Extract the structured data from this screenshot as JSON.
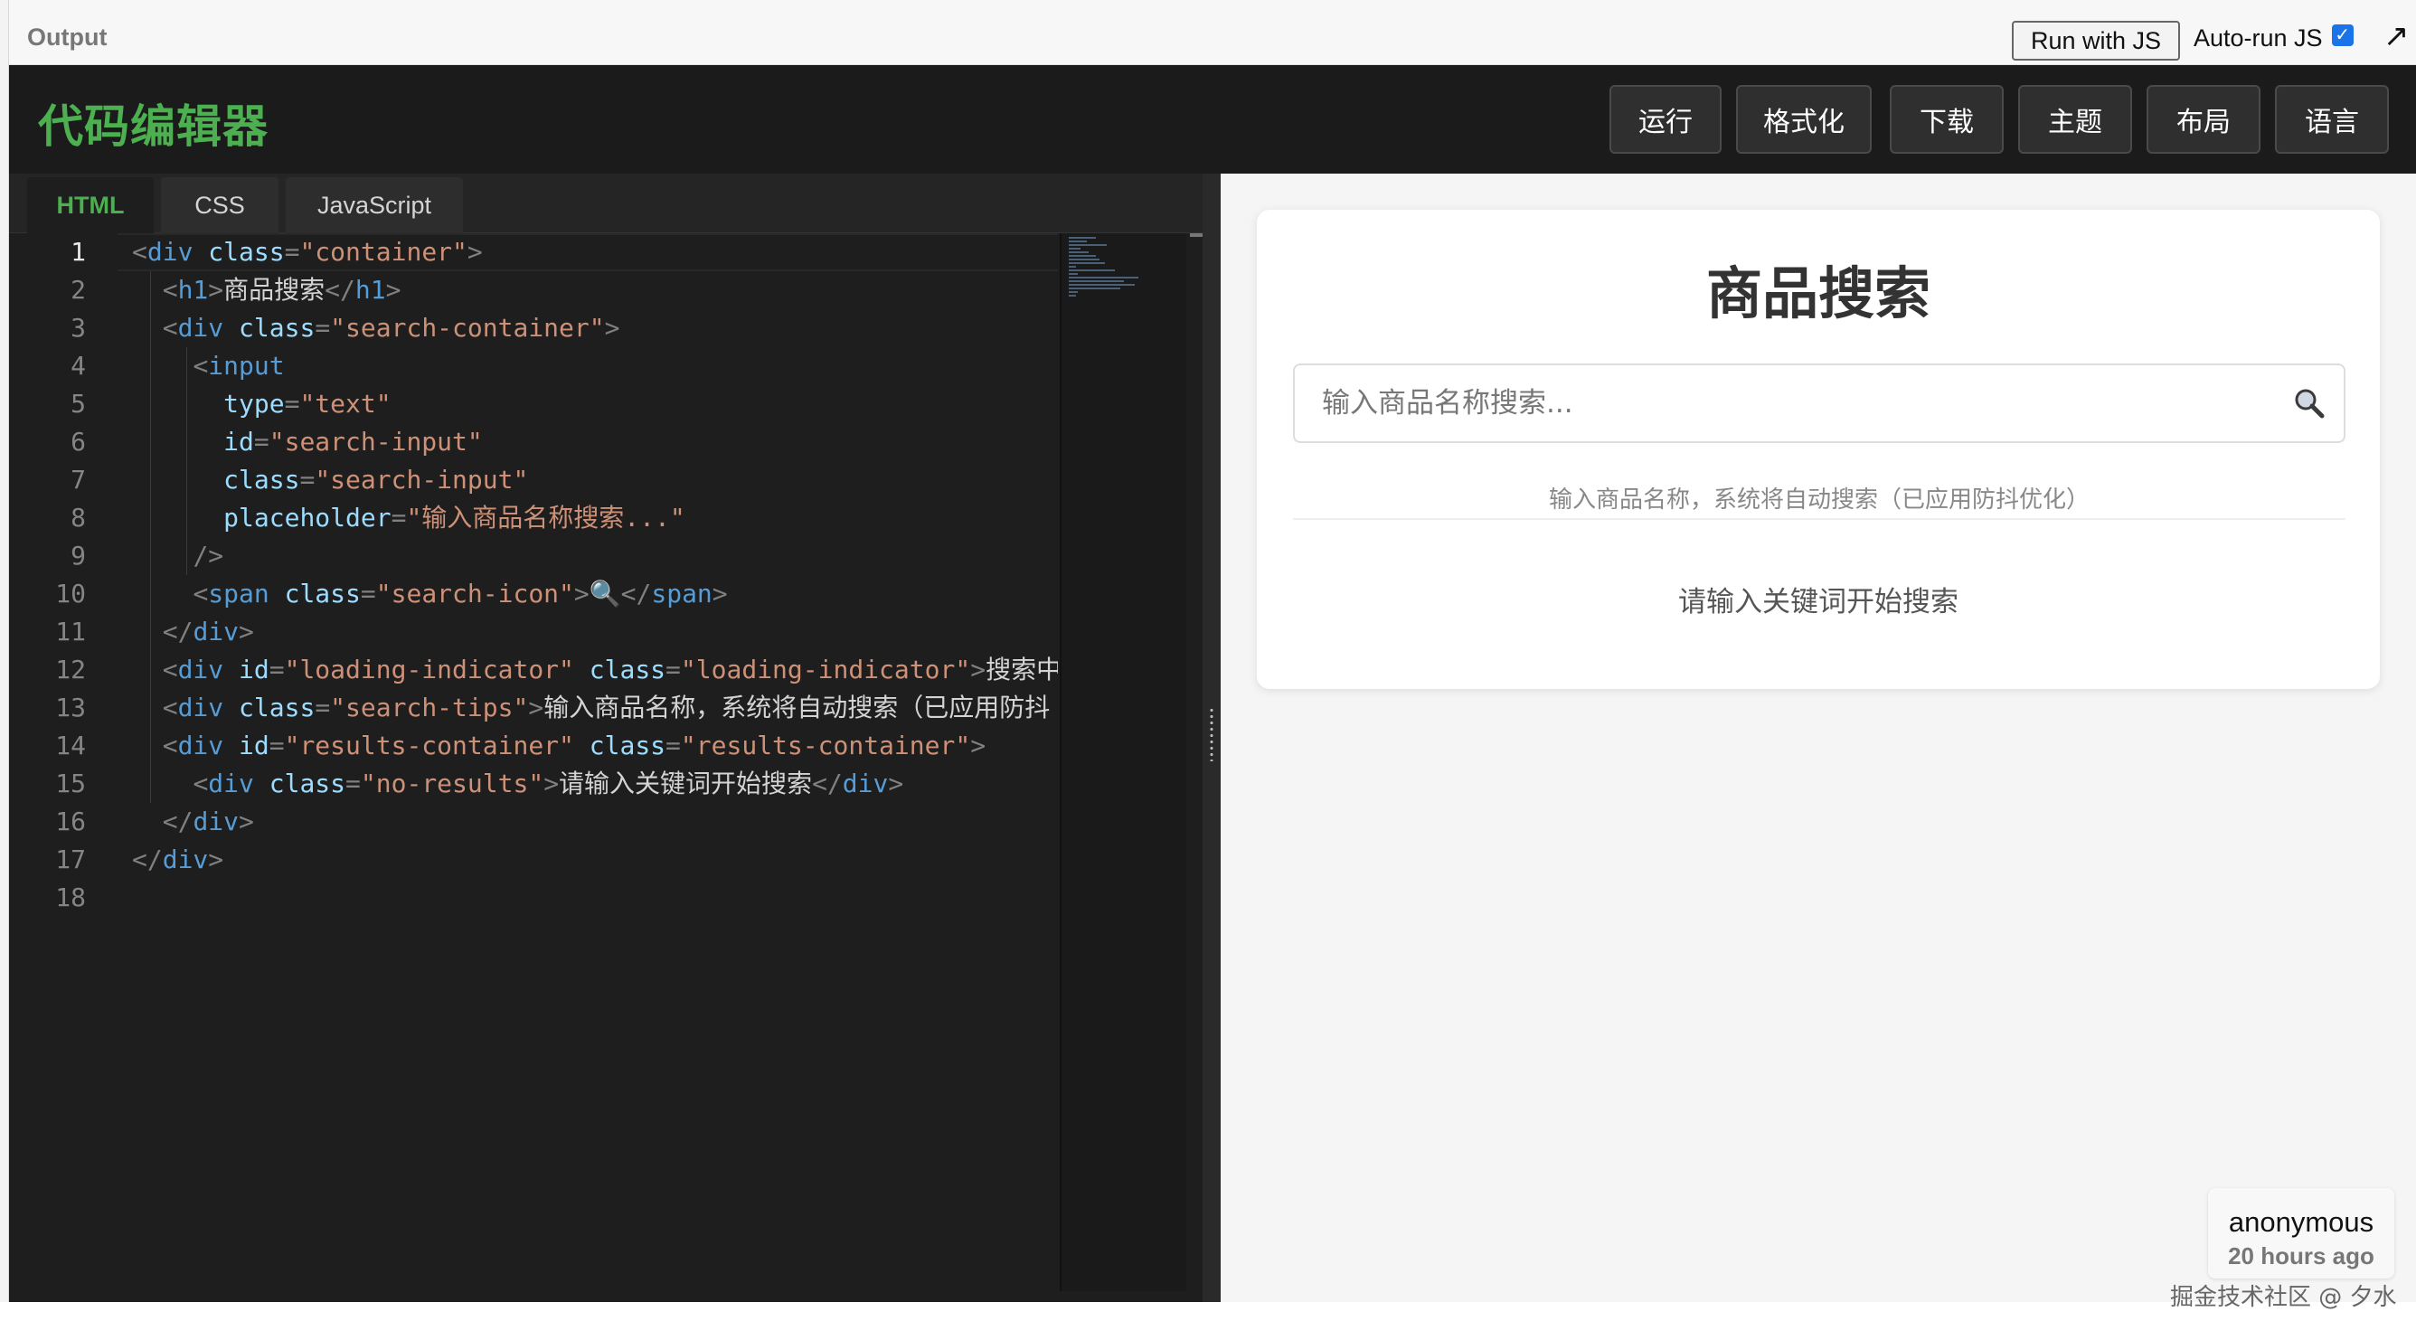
{
  "output_bar": {
    "title": "Output",
    "run_button": "Run with JS",
    "autorun_label": "Auto-run JS",
    "autorun_checked": true,
    "popout_icon": "arrow-up-right-icon"
  },
  "app": {
    "logo": "代码编辑器",
    "accent_color": "#4caf50",
    "buttons": [
      "运行",
      "格式化",
      "下载",
      "主题",
      "布局",
      "语言"
    ]
  },
  "editor": {
    "tabs": [
      "HTML",
      "CSS",
      "JavaScript"
    ],
    "active_tab": "HTML",
    "current_line": 1,
    "line_numbers": [
      "1",
      "2",
      "3",
      "4",
      "5",
      "6",
      "7",
      "8",
      "9",
      "10",
      "11",
      "12",
      "13",
      "14",
      "15",
      "16",
      "17",
      "18"
    ],
    "lines": [
      [
        [
          "br",
          "<"
        ],
        [
          "tag",
          "div"
        ],
        [
          "txt",
          " "
        ],
        [
          "attr",
          "class"
        ],
        [
          "br",
          "="
        ],
        [
          "str",
          "\"container\""
        ],
        [
          "br",
          ">"
        ]
      ],
      [
        [
          "txt",
          "  "
        ],
        [
          "br",
          "<"
        ],
        [
          "tag",
          "h1"
        ],
        [
          "br",
          ">"
        ],
        [
          "txt",
          "商品搜索"
        ],
        [
          "br",
          "</"
        ],
        [
          "tag",
          "h1"
        ],
        [
          "br",
          ">"
        ]
      ],
      [
        [
          "txt",
          "  "
        ],
        [
          "br",
          "<"
        ],
        [
          "tag",
          "div"
        ],
        [
          "txt",
          " "
        ],
        [
          "attr",
          "class"
        ],
        [
          "br",
          "="
        ],
        [
          "str",
          "\"search-container\""
        ],
        [
          "br",
          ">"
        ]
      ],
      [
        [
          "txt",
          "    "
        ],
        [
          "br",
          "<"
        ],
        [
          "tag",
          "input"
        ]
      ],
      [
        [
          "txt",
          "      "
        ],
        [
          "attr",
          "type"
        ],
        [
          "br",
          "="
        ],
        [
          "str",
          "\"text\""
        ]
      ],
      [
        [
          "txt",
          "      "
        ],
        [
          "attr",
          "id"
        ],
        [
          "br",
          "="
        ],
        [
          "str",
          "\"search-input\""
        ]
      ],
      [
        [
          "txt",
          "      "
        ],
        [
          "attr",
          "class"
        ],
        [
          "br",
          "="
        ],
        [
          "str",
          "\"search-input\""
        ]
      ],
      [
        [
          "txt",
          "      "
        ],
        [
          "attr",
          "placeholder"
        ],
        [
          "br",
          "="
        ],
        [
          "str",
          "\"输入商品名称搜索...\""
        ]
      ],
      [
        [
          "txt",
          "    "
        ],
        [
          "br",
          "/>"
        ]
      ],
      [
        [
          "txt",
          "    "
        ],
        [
          "br",
          "<"
        ],
        [
          "tag",
          "span"
        ],
        [
          "txt",
          " "
        ],
        [
          "attr",
          "class"
        ],
        [
          "br",
          "="
        ],
        [
          "str",
          "\"search-icon\""
        ],
        [
          "br",
          ">"
        ],
        [
          "txt",
          "🔍"
        ],
        [
          "br",
          "</"
        ],
        [
          "tag",
          "span"
        ],
        [
          "br",
          ">"
        ]
      ],
      [
        [
          "txt",
          "  "
        ],
        [
          "br",
          "</"
        ],
        [
          "tag",
          "div"
        ],
        [
          "br",
          ">"
        ]
      ],
      [
        [
          "txt",
          "  "
        ],
        [
          "br",
          "<"
        ],
        [
          "tag",
          "div"
        ],
        [
          "txt",
          " "
        ],
        [
          "attr",
          "id"
        ],
        [
          "br",
          "="
        ],
        [
          "str",
          "\"loading-indicator\""
        ],
        [
          "txt",
          " "
        ],
        [
          "attr",
          "class"
        ],
        [
          "br",
          "="
        ],
        [
          "str",
          "\"loading-indicator\""
        ],
        [
          "br",
          ">"
        ],
        [
          "txt",
          "搜索中"
        ]
      ],
      [
        [
          "txt",
          "  "
        ],
        [
          "br",
          "<"
        ],
        [
          "tag",
          "div"
        ],
        [
          "txt",
          " "
        ],
        [
          "attr",
          "class"
        ],
        [
          "br",
          "="
        ],
        [
          "str",
          "\"search-tips\""
        ],
        [
          "br",
          ">"
        ],
        [
          "txt",
          "输入商品名称，系统将自动搜索（已应用防抖"
        ]
      ],
      [
        [
          "txt",
          "  "
        ],
        [
          "br",
          "<"
        ],
        [
          "tag",
          "div"
        ],
        [
          "txt",
          " "
        ],
        [
          "attr",
          "id"
        ],
        [
          "br",
          "="
        ],
        [
          "str",
          "\"results-container\""
        ],
        [
          "txt",
          " "
        ],
        [
          "attr",
          "class"
        ],
        [
          "br",
          "="
        ],
        [
          "str",
          "\"results-container\""
        ],
        [
          "br",
          ">"
        ]
      ],
      [
        [
          "txt",
          "    "
        ],
        [
          "br",
          "<"
        ],
        [
          "tag",
          "div"
        ],
        [
          "txt",
          " "
        ],
        [
          "attr",
          "class"
        ],
        [
          "br",
          "="
        ],
        [
          "str",
          "\"no-results\""
        ],
        [
          "br",
          ">"
        ],
        [
          "txt",
          "请输入关键词开始搜索"
        ],
        [
          "br",
          "</"
        ],
        [
          "tag",
          "div"
        ],
        [
          "br",
          ">"
        ]
      ],
      [
        [
          "txt",
          "  "
        ],
        [
          "br",
          "</"
        ],
        [
          "tag",
          "div"
        ],
        [
          "br",
          ">"
        ]
      ],
      [
        [
          "br",
          "</"
        ],
        [
          "tag",
          "div"
        ],
        [
          "br",
          ">"
        ]
      ],
      []
    ]
  },
  "preview": {
    "title": "商品搜索",
    "search_placeholder": "输入商品名称搜索...",
    "search_icon": "search-icon",
    "tips": "输入商品名称，系统将自动搜索（已应用防抖优化）",
    "no_results": "请输入关键词开始搜索"
  },
  "user": {
    "name": "anonymous",
    "time": "20 hours ago"
  },
  "watermark": "掘金技术社区 @ 夕水"
}
